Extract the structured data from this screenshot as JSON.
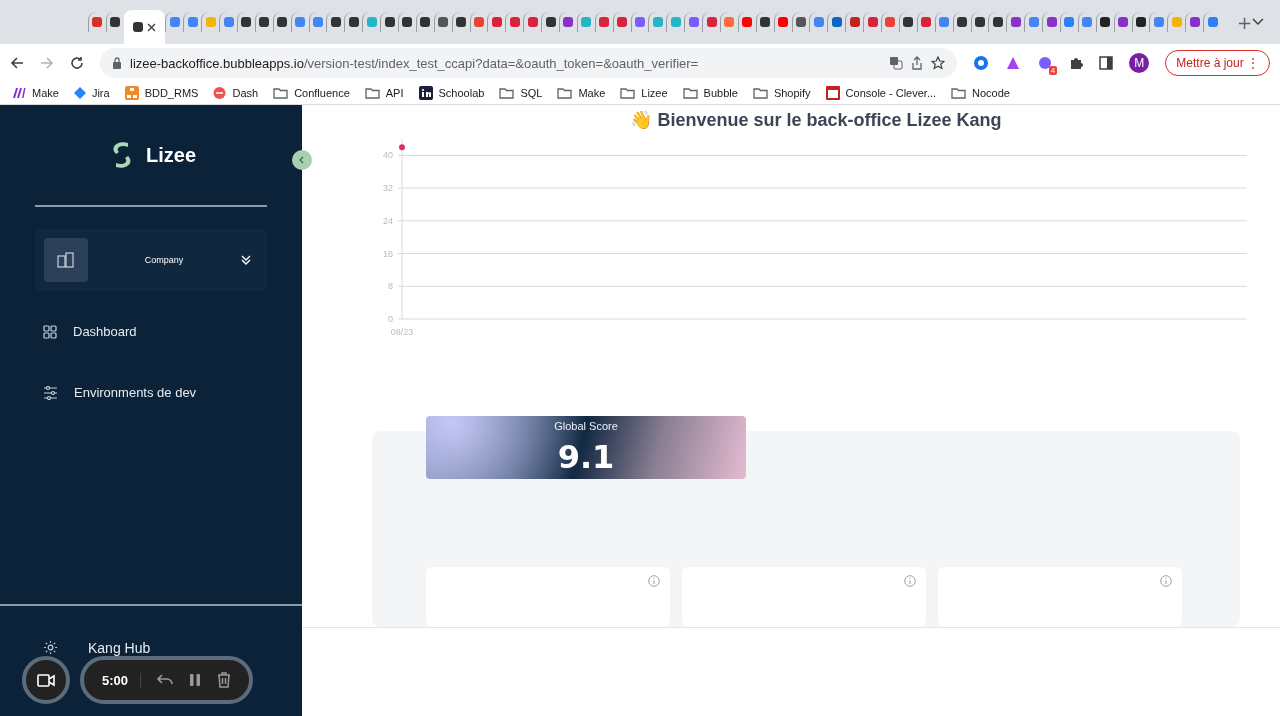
{
  "browser": {
    "tabs": [
      {
        "selected": false,
        "color": "#d93025"
      },
      {
        "selected": false,
        "color": "#333333"
      },
      {
        "selected": true,
        "color": "#333333"
      },
      {
        "selected": false,
        "color": "#4285f4"
      },
      {
        "selected": false,
        "color": "#4285f4"
      },
      {
        "selected": false,
        "color": "#f4b400"
      },
      {
        "selected": false,
        "color": "#4285f4"
      },
      {
        "selected": false,
        "color": "#333333"
      },
      {
        "selected": false,
        "color": "#333333"
      },
      {
        "selected": false,
        "color": "#333333"
      },
      {
        "selected": false,
        "color": "#4285f4"
      },
      {
        "selected": false,
        "color": "#4285f4"
      },
      {
        "selected": false,
        "color": "#333333"
      },
      {
        "selected": false,
        "color": "#333333"
      },
      {
        "selected": false,
        "color": "#26b5c6"
      },
      {
        "selected": false,
        "color": "#333333"
      },
      {
        "selected": false,
        "color": "#333333"
      },
      {
        "selected": false,
        "color": "#333333"
      },
      {
        "selected": false,
        "color": "#555555"
      },
      {
        "selected": false,
        "color": "#333333"
      },
      {
        "selected": false,
        "color": "#ea4335"
      },
      {
        "selected": false,
        "color": "#d8233a"
      },
      {
        "selected": false,
        "color": "#d8233a"
      },
      {
        "selected": false,
        "color": "#d8233a"
      },
      {
        "selected": false,
        "color": "#333333"
      },
      {
        "selected": false,
        "color": "#8b2fc9"
      },
      {
        "selected": false,
        "color": "#26b5c6"
      },
      {
        "selected": false,
        "color": "#d8233a"
      },
      {
        "selected": false,
        "color": "#d8233a"
      },
      {
        "selected": false,
        "color": "#7b5cff"
      },
      {
        "selected": false,
        "color": "#26b5c6"
      },
      {
        "selected": false,
        "color": "#26b5c6"
      },
      {
        "selected": false,
        "color": "#7b5cff"
      },
      {
        "selected": false,
        "color": "#d8233a"
      },
      {
        "selected": false,
        "color": "#ff6a3d"
      },
      {
        "selected": false,
        "color": "#ff0000"
      },
      {
        "selected": false,
        "color": "#333333"
      },
      {
        "selected": false,
        "color": "#ff0000"
      },
      {
        "selected": false,
        "color": "#555555"
      },
      {
        "selected": false,
        "color": "#4285f4"
      },
      {
        "selected": false,
        "color": "#0a66c2"
      },
      {
        "selected": false,
        "color": "#c5221f"
      },
      {
        "selected": false,
        "color": "#d8233a"
      },
      {
        "selected": false,
        "color": "#ea4335"
      },
      {
        "selected": false,
        "color": "#333333"
      },
      {
        "selected": false,
        "color": "#d8233a"
      },
      {
        "selected": false,
        "color": "#4285f4"
      },
      {
        "selected": false,
        "color": "#333333"
      },
      {
        "selected": false,
        "color": "#333333"
      },
      {
        "selected": false,
        "color": "#333333"
      },
      {
        "selected": false,
        "color": "#8b2fc9"
      },
      {
        "selected": false,
        "color": "#4285f4"
      },
      {
        "selected": false,
        "color": "#8b2fc9"
      },
      {
        "selected": false,
        "color": "#2d7ff9"
      },
      {
        "selected": false,
        "color": "#4285f4"
      },
      {
        "selected": false,
        "color": "#222222"
      },
      {
        "selected": false,
        "color": "#8b2fc9"
      },
      {
        "selected": false,
        "color": "#222222"
      },
      {
        "selected": false,
        "color": "#4285f4"
      },
      {
        "selected": false,
        "color": "#f4b400"
      },
      {
        "selected": false,
        "color": "#8b2fc9"
      },
      {
        "selected": false,
        "color": "#2d7ff9"
      }
    ],
    "new_tab": "+",
    "url": {
      "domain": "lizee-backoffice.bubbleapps.io",
      "path": "/version-test/index_test_ccapi?data=&oauth_token=&oauth_verifier="
    },
    "profile_initial": "M",
    "update_button": "Mettre à jour",
    "update_menu": "⋮",
    "extension_badge": "4",
    "bookmarks": [
      {
        "label": "Make",
        "kind": "make"
      },
      {
        "label": "Jira",
        "kind": "jira"
      },
      {
        "label": "BDD_RMS",
        "kind": "bdd"
      },
      {
        "label": "Dash",
        "kind": "dash"
      },
      {
        "label": "Confluence",
        "kind": "folder"
      },
      {
        "label": "API",
        "kind": "folder"
      },
      {
        "label": "Schoolab",
        "kind": "linkedin"
      },
      {
        "label": "SQL",
        "kind": "folder"
      },
      {
        "label": "Make",
        "kind": "folder"
      },
      {
        "label": "Lizee",
        "kind": "folder"
      },
      {
        "label": "Bubble",
        "kind": "folder"
      },
      {
        "label": "Shopify",
        "kind": "folder"
      },
      {
        "label": "Console - Clever...",
        "kind": "console"
      },
      {
        "label": "Nocode",
        "kind": "folder"
      }
    ]
  },
  "sidebar": {
    "brand": "Lizee",
    "company": {
      "label": "Company"
    },
    "items": [
      {
        "label": "Dashboard",
        "kind": "grid"
      },
      {
        "label": "Environments de dev",
        "kind": "sliders"
      }
    ],
    "footer": {
      "label": "Kang Hub"
    }
  },
  "recorder": {
    "time": "5:00"
  },
  "main": {
    "title_emoji": "👋",
    "title": "Bienvenue sur le back-office Lizee Kang",
    "chart_data": {
      "type": "line",
      "categories": [
        "08/23"
      ],
      "series": [
        {
          "color": "#d6336c",
          "marker": "circle",
          "values": [
            42
          ]
        }
      ],
      "ylim": [
        0,
        44
      ],
      "grid": true,
      "yticks": [
        0,
        8,
        16,
        24,
        32,
        40
      ]
    },
    "score": {
      "label": "Global Score",
      "value": "9.1"
    },
    "cards": [
      {
        "kind": "metric"
      },
      {
        "kind": "metric"
      },
      {
        "kind": "metric"
      }
    ]
  }
}
